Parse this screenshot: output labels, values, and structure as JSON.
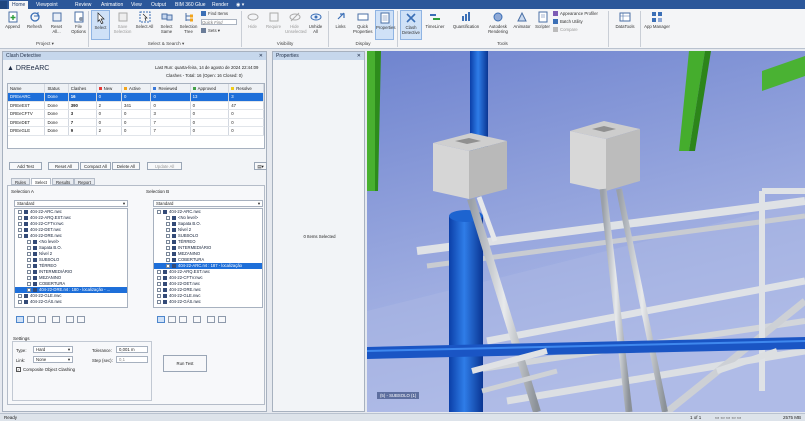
{
  "ribbon_tabs": [
    "Home",
    "Viewpoint",
    "Review",
    "Animation",
    "View",
    "Output",
    "BIM 360 Glue",
    "Render"
  ],
  "project_group": {
    "label": "Project",
    "buttons": [
      {
        "label": "Append"
      },
      {
        "label": "Refresh"
      },
      {
        "label": "Reset All..."
      },
      {
        "label": "File Options"
      }
    ]
  },
  "select_group": {
    "label": "Select & Search",
    "buttons": [
      {
        "label": "Select"
      },
      {
        "label": "Save Selection"
      },
      {
        "label": "Select All"
      },
      {
        "label": "Select Same"
      },
      {
        "label": "Selection Tree"
      }
    ],
    "find_items": "Find Items",
    "quick_find": "Quick Find",
    "sets": "Sets"
  },
  "visibility_group": {
    "label": "Visibility",
    "buttons": [
      {
        "label": "Hide"
      },
      {
        "label": "Require"
      },
      {
        "label": "Hide Unselected"
      },
      {
        "label": "Unhide All"
      }
    ]
  },
  "display_group": {
    "label": "Display",
    "buttons": [
      {
        "label": "Links"
      },
      {
        "label": "Quick Properties"
      },
      {
        "label": "Properties"
      }
    ]
  },
  "tools_group": {
    "label": "Tools",
    "buttons": [
      {
        "label": "Clash Detective"
      },
      {
        "label": "TimeLiner"
      },
      {
        "label": "Quantification"
      },
      {
        "label": "Autodesk Rendering"
      },
      {
        "label": "Animator"
      },
      {
        "label": "Scripter"
      }
    ],
    "small": [
      "Appearance Profiler",
      "Batch Utility",
      "Compare"
    ]
  },
  "datatools": {
    "label": "DataTools"
  },
  "appmanager": {
    "label": "App Manager"
  },
  "clash_panel": {
    "title": "Clash Detective",
    "test_name": "DREeARC",
    "last_run": "Last Run:  quarta-feira, 14 de agosto de 2024 22:44:09",
    "clashes_summary": "Clashes - Total: 16  (Open: 16  Closed: 0)",
    "columns": [
      "Name",
      "Status",
      "Clashes",
      "New",
      "Active",
      "Reviewed",
      "Approved",
      "Resolve"
    ],
    "col_colors": [
      "",
      "",
      "",
      "#e53935",
      "#f2a41a",
      "#3a78d8",
      "#43a047",
      "#f0cc17"
    ],
    "rows": [
      [
        "DREeARC",
        "Done",
        "16",
        "0",
        "0",
        "0",
        "13",
        "3"
      ],
      [
        "DREeEST",
        "Done",
        "390",
        "2",
        "341",
        "0",
        "0",
        "47"
      ],
      [
        "DREeCFTV",
        "Done",
        "3",
        "0",
        "0",
        "3",
        "0",
        "0"
      ],
      [
        "DREeDET",
        "Done",
        "7",
        "0",
        "0",
        "7",
        "0",
        "0"
      ],
      [
        "DREeGLE",
        "Done",
        "9",
        "2",
        "0",
        "7",
        "0",
        "0"
      ]
    ],
    "buttons": {
      "add": "Add Test",
      "reset": "Reset All",
      "compact": "Compact All",
      "delete": "Delete All",
      "update": "Update All"
    },
    "tabs": [
      "Rules",
      "Select",
      "Results",
      "Report"
    ],
    "selection_a": {
      "label": "Selection A",
      "dropdown": "Standard",
      "tree": [
        "404-22-ARC.nwc",
        "404-22-ARQ.EST.nwc",
        "404-22-CFTV.nwc",
        "404-22-DET.nwc",
        "404-22-DRE.nwc",
        "<No level>",
        "Sapata B.O.",
        "Nível 2",
        "SUBSOLO",
        "TÉRREO",
        "INTERMEDIÁRIO",
        "MEZANINO",
        "COBERTURA",
        "404-22-DRE.rvt : 180 - localização - ...",
        "404-22-GLE.nwc",
        "404-22-GÁS.nwc"
      ]
    },
    "selection_b": {
      "label": "Selection B",
      "dropdown": "Standard",
      "tree": [
        "404-22-ARC.nwc",
        "<No level>",
        "Sapata B.O.",
        "Nível 2",
        "SUBSOLO",
        "TÉRREO",
        "INTERMEDIÁRIO",
        "MEZANINO",
        "COBERTURA",
        "404-22-ARC.rvt : 187 - localização",
        "404-22-ARQ.EST.nwc",
        "404-22-CFTV.nwc",
        "404-22-DET.nwc",
        "404-22-DRE.nwc",
        "404-22-GLE.nwc",
        "404-22-GÁS.nwc"
      ]
    },
    "settings": {
      "label": "Settings",
      "type_label": "Type:",
      "type_value": "Hard",
      "tolerance_label": "Tolerance:",
      "tolerance_value": "0,001 m",
      "link_label": "Link:",
      "link_value": "None",
      "step_label": "Step (sec):",
      "step_value": "0,1",
      "composite": "Composite Object Clashing",
      "run": "Run Test"
    }
  },
  "properties_panel": {
    "title": "Properties",
    "empty": "0 Items Selected"
  },
  "viewport": {
    "level_label": "(5) - SUBSOLO (1)"
  },
  "status": {
    "ready": "Ready",
    "pages": "1 of 1",
    "memory": "2575 MB"
  }
}
